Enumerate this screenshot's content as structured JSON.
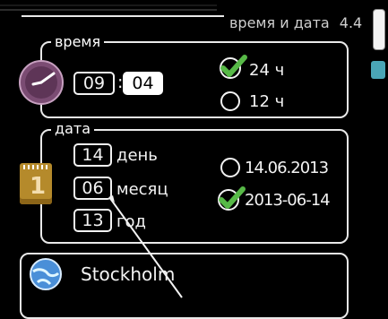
{
  "header": {
    "title": "время и дата",
    "page_id": "4.4"
  },
  "time_panel": {
    "legend": "время",
    "hours": "09",
    "separator": ":",
    "minutes": "04",
    "format_options": [
      {
        "label": "24 ч",
        "checked": true
      },
      {
        "label": "12 ч",
        "checked": false
      }
    ]
  },
  "date_panel": {
    "legend": "дата",
    "day_value": "14",
    "day_label": "день",
    "month_value": "06",
    "month_label": "месяц",
    "year_value": "13",
    "year_label": "год",
    "calendar_day": "1",
    "format_options": [
      {
        "label": "14.06.2013",
        "checked": false
      },
      {
        "label": "2013-06-14",
        "checked": true
      }
    ]
  },
  "location_panel": {
    "city": "Stockholm"
  },
  "colors": {
    "accent_check": "#57b947",
    "clock_purple": "#7b4c73",
    "calendar_gold": "#b58a2b",
    "side_cyan": "#4aa5b6"
  },
  "icons": [
    "clock-icon",
    "calendar-icon",
    "globe-icon",
    "check-icon",
    "radio-icon",
    "scroll-indicator-icon"
  ]
}
